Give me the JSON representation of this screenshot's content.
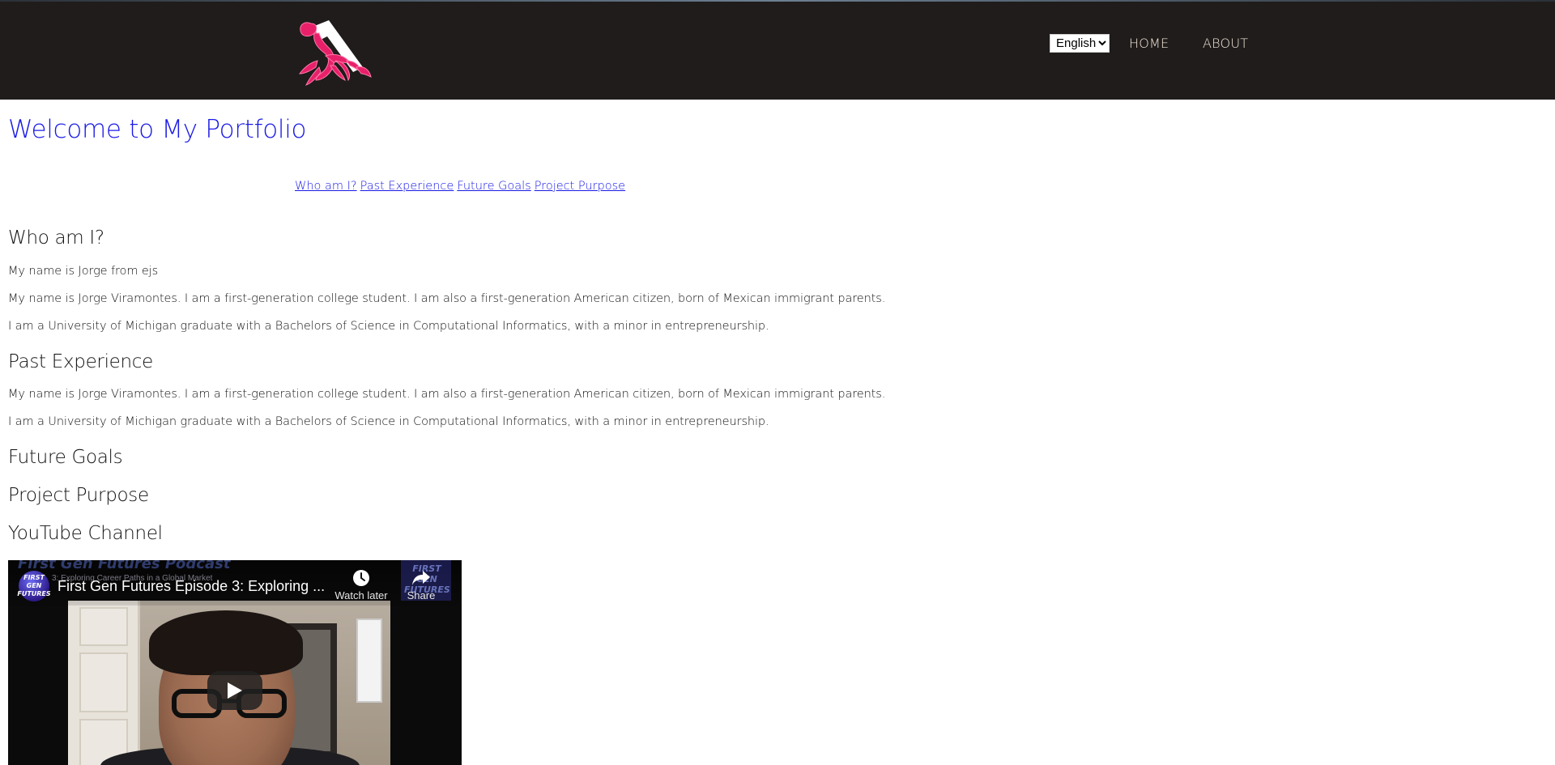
{
  "header": {
    "language_selected": "English",
    "language_options": [
      "English"
    ],
    "nav": {
      "home": "HOME",
      "about": "ABOUT"
    },
    "logo_icon": "scorpion-logo-icon",
    "colors": {
      "background": "#1f1c1b",
      "link": "#f4e7da",
      "logo": "#e8206a"
    }
  },
  "main": {
    "title": "Welcome to My Portfolio",
    "toc": [
      {
        "label": "Who am I?"
      },
      {
        "label": "Past Experience"
      },
      {
        "label": "Future Goals"
      },
      {
        "label": "Project Purpose"
      }
    ],
    "sections": {
      "who": {
        "heading": "Who am I?",
        "paragraphs": [
          "My name is Jorge from ejs",
          "My name is Jorge Viramontes. I am a first-generation college student. I am also a first-generation American citizen, born of Mexican immigrant parents.",
          "I am a University of Michigan graduate with a Bachelors of Science in Computational Informatics, with a minor in entrepreneurship."
        ]
      },
      "past": {
        "heading": "Past Experience",
        "paragraphs": [
          "My name is Jorge Viramontes. I am a first-generation college student. I am also a first-generation American citizen, born of Mexican immigrant parents.",
          "I am a University of Michigan graduate with a Bachelors of Science in Computational Informatics, with a minor in entrepreneurship."
        ]
      },
      "future": {
        "heading": "Future Goals"
      },
      "purpose": {
        "heading": "Project Purpose"
      },
      "youtube": {
        "heading": "YouTube Channel"
      }
    },
    "video": {
      "title": "First Gen Futures Episode 3: Exploring ...",
      "background_title": "First Gen Futures Podcast",
      "background_subtitle": "3: Exploring Career Paths in a Global Market",
      "channel_avatar_text": "FIRST GEN FUTURES",
      "corner_text": "FIRST GEN FUTURES",
      "watch_later": "Watch later",
      "share": "Share"
    },
    "colors": {
      "title": "#1a1ae6",
      "link": "#1a1ae6",
      "text": "#111111"
    }
  }
}
